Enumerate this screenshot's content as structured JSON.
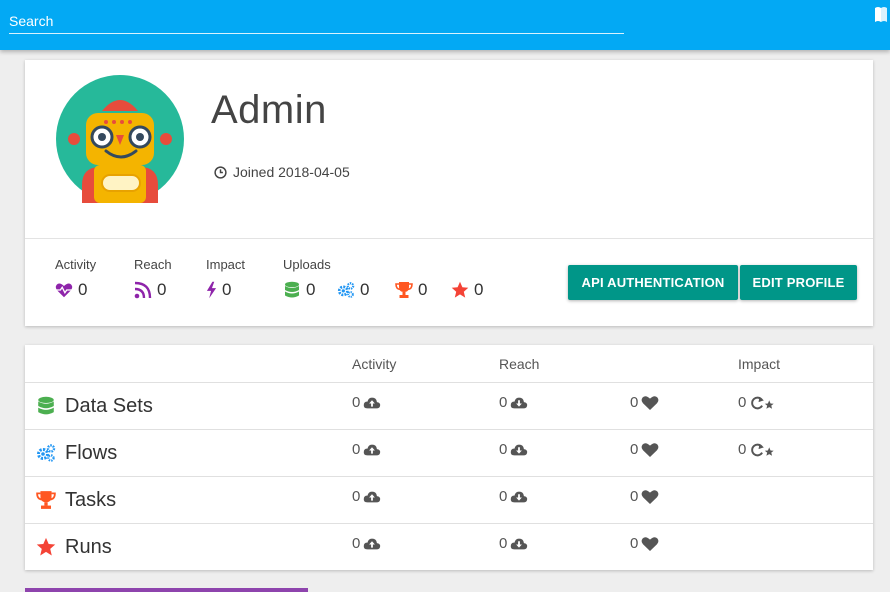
{
  "search": {
    "placeholder": "Search"
  },
  "profile": {
    "name": "Admin",
    "joined": "Joined 2018-04-05",
    "stats": {
      "activity_label": "Activity",
      "activity_value": "0",
      "reach_label": "Reach",
      "reach_value": "0",
      "impact_label": "Impact",
      "impact_value": "0",
      "uploads_label": "Uploads",
      "uploads_datasets": "0",
      "uploads_flows": "0",
      "uploads_tasks": "0",
      "uploads_runs": "0"
    },
    "buttons": {
      "api_auth": "API AUTHENTICATION",
      "edit_profile": "EDIT PROFILE"
    }
  },
  "table": {
    "headers": {
      "activity": "Activity",
      "reach": "Reach",
      "impact": "Impact"
    },
    "rows": [
      {
        "label": "Data Sets",
        "icon": "database-icon",
        "activity": "0",
        "reach": "0",
        "likes": "0",
        "impact": "0"
      },
      {
        "label": "Flows",
        "icon": "cogs-icon",
        "activity": "0",
        "reach": "0",
        "likes": "0",
        "impact": "0"
      },
      {
        "label": "Tasks",
        "icon": "trophy-icon",
        "activity": "0",
        "reach": "0",
        "likes": "0"
      },
      {
        "label": "Runs",
        "icon": "star-icon",
        "activity": "0",
        "reach": "0",
        "likes": "0"
      }
    ]
  },
  "colors": {
    "topbar": "#03a9f4",
    "button": "#009688",
    "activity": "#8e24aa",
    "datasets": "#4caf50",
    "flows": "#2196f3",
    "tasks": "#ff5722",
    "runs": "#f44336"
  }
}
